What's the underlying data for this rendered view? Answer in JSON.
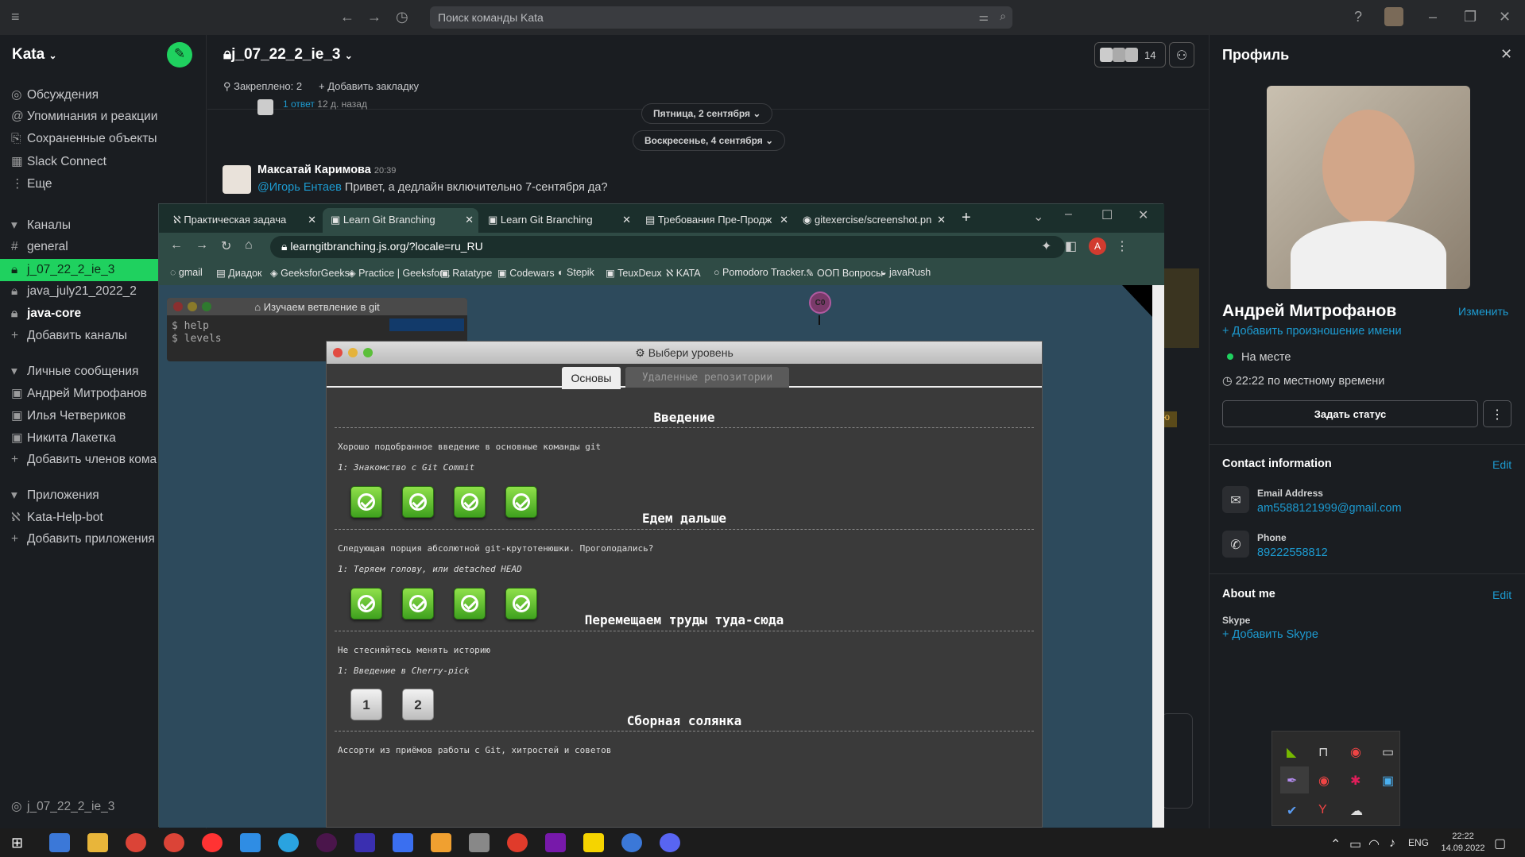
{
  "topbar": {
    "search_placeholder": "Поиск команды Kata"
  },
  "workspace": {
    "name": "Kata"
  },
  "sidebar": {
    "nav": [
      "Обсуждения",
      "Упоминания и реакции",
      "Сохраненные объекты",
      "Slack Connect",
      "Еще"
    ],
    "channels_header": "Каналы",
    "channels": [
      "general",
      "j_07_22_2_ie_3",
      "java_july21_2022_2",
      "java-core",
      "Добавить каналы"
    ],
    "dm_header": "Личные сообщения",
    "dms": [
      "Андрей Митрофанов",
      "Илья Четвериков",
      "Никита Лакетка",
      "Добавить членов кома"
    ],
    "apps_header": "Приложения",
    "apps": [
      "Kata-Help-bot",
      "Добавить приложения"
    ],
    "footer_channel": "j_07_22_2_ie_3"
  },
  "channel": {
    "name": "j_07_22_2_ie_3",
    "member_count": "14",
    "pinned": "Закреплено: 2",
    "add_bookmark": "Добавить закладку",
    "reply_frag": "1 ответ",
    "reply_time": "12 д. назад",
    "date1": "Пятница, 2 сентября",
    "date2": "Воскресенье, 4 сентября",
    "msg_author": "Максатай Каримова",
    "msg_time": "20:39",
    "msg_mention": "@Игорь Ентаев",
    "msg_text": "Привет, а дедлайн включительно 7-сентября да?",
    "side_frag": "ю"
  },
  "chrome": {
    "tabs": [
      "Практическая задача",
      "Learn Git Branching",
      "Learn Git Branching",
      "Требования Пре-Продж",
      "gitexercise/screenshot.pn"
    ],
    "url": "learngitbranching.js.org/?locale=ru_RU",
    "avatar_letter": "A",
    "bookmarks": [
      "gmail",
      "Диадок",
      "GeeksforGeeks",
      "Practice | Geeksfor...",
      "Ratatype",
      "Codewars",
      "Stepik",
      "TeuxDeux",
      "KATA",
      "Pomodoro Tracker...",
      "ООП Вопросы",
      "javaRush"
    ]
  },
  "terminal": {
    "title": "Изучаем ветвление в git",
    "lines": [
      "$ help",
      "$ levels"
    ]
  },
  "git_node": "C0",
  "modal": {
    "title": "Выбери уровень",
    "tab_main": "Основы",
    "tab_remote": "Удаленные репозитории",
    "sections": [
      {
        "title": "Введение",
        "desc": "Хорошо подобранное введение в основные команды git",
        "level": "1: Знакомство с Git Commit"
      },
      {
        "title": "Едем дальше",
        "desc": "Следующая порция абсолютной git-крутотенюшки. Проголодались?",
        "level": "1: Теряем голову, или detached HEAD"
      },
      {
        "title": "Перемещаем труды туда-сюда",
        "desc": "Не стесняйтесь менять историю",
        "level": "1: Введение в Cherry-pick"
      },
      {
        "title": "Сборная солянка",
        "desc": "Ассорти из приёмов работы с Git, хитростей и советов"
      }
    ],
    "grey_levels": [
      "1",
      "2"
    ]
  },
  "profile": {
    "header": "Профиль",
    "name": "Андрей Митрофанов",
    "edit": "Изменить",
    "add_pronunciation": "+ Добавить произношение имени",
    "presence": "На месте",
    "local_time": "22:22 по местному времени",
    "set_status": "Задать статус",
    "contact_header": "Contact information",
    "contact_edit": "Edit",
    "email_label": "Email Address",
    "email": "am5588121999@gmail.com",
    "phone_label": "Phone",
    "phone": "89222558812",
    "about_header": "About me",
    "about_edit": "Edit",
    "skype_label": "Skype",
    "skype_add": "+ Добавить Skype"
  },
  "taskbar": {
    "lang": "ENG",
    "time": "22:22",
    "date": "14.09.2022"
  },
  "colors": {
    "accent": "#1fd15f",
    "link": "#1d9bd1"
  }
}
